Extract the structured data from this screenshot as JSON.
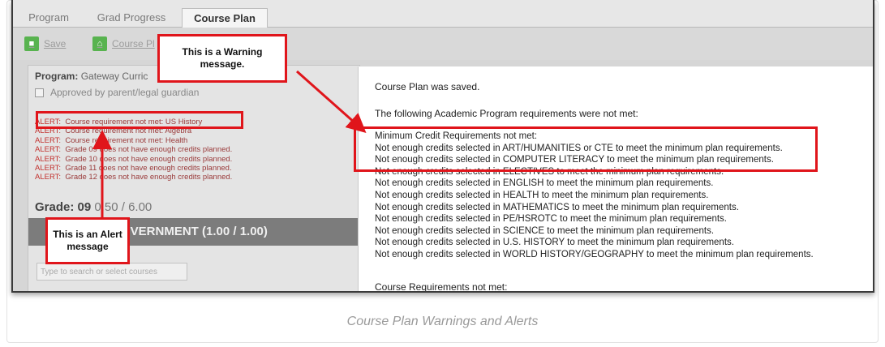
{
  "tabs": [
    {
      "label": "Program"
    },
    {
      "label": "Grad Progress"
    },
    {
      "label": "Course Plan"
    }
  ],
  "toolbar": {
    "save_label": "Save",
    "course_plan_label": "Course Pl"
  },
  "program": {
    "label": "Program:",
    "value": "Gateway Curric",
    "approved_label": "Approved by parent/legal guardian"
  },
  "alerts": [
    {
      "prefix": "ALERT:",
      "text": "Course requirement not met: US History"
    },
    {
      "prefix": "ALERT:",
      "text": "Course requirement not met: Algebra"
    },
    {
      "prefix": "ALERT:",
      "text": "Course requirement not met: Health"
    },
    {
      "prefix": "ALERT:",
      "text": "Grade 09 does not have enough credits planned."
    },
    {
      "prefix": "ALERT:",
      "text": "Grade 10 does not have enough credits planned."
    },
    {
      "prefix": "ALERT:",
      "text": "Grade 11 does not have enough credits planned."
    },
    {
      "prefix": "ALERT:",
      "text": "Grade 12 does not have enough credits planned."
    }
  ],
  "grade": {
    "label": "Grade: 09",
    "value": "0.50 / 6.00"
  },
  "gov_bar": {
    "text": "OVERNMENT (1.00 / 1.00)"
  },
  "search": {
    "placeholder": "Type to search or select courses"
  },
  "dialog": {
    "saved": "Course Plan was saved.",
    "intro": "The following Academic Program requirements were not met:",
    "requirements": [
      "Minimum Credit Requirements not met:",
      "Not enough credits selected in ART/HUMANITIES or CTE to meet the minimum plan requirements.",
      "Not enough credits selected in COMPUTER LITERACY to meet the minimum plan requirements.",
      "Not enough credits selected in ELECTIVES to meet the minimum plan requirements.",
      "Not enough credits selected in ENGLISH to meet the minimum plan requirements.",
      "Not enough credits selected in HEALTH to meet the minimum plan requirements.",
      "Not enough credits selected in MATHEMATICS to meet the minimum plan requirements.",
      "Not enough credits selected in PE/HSROTC to meet the minimum plan requirements.",
      "Not enough credits selected in SCIENCE to meet the minimum plan requirements.",
      "Not enough credits selected in U.S. HISTORY to meet the minimum plan requirements.",
      "Not enough credits selected in WORLD HISTORY/GEOGRAPHY to meet the minimum plan requirements."
    ],
    "course_req": "Course Requirements not met:"
  },
  "callouts": {
    "warning": "This is a Warning message.",
    "alert": "This is an Alert message"
  },
  "caption": "Course Plan Warnings and Alerts",
  "colors": {
    "highlight": "#e0151b",
    "alert_text": "#c2312e",
    "save_green": "#58b34f"
  }
}
